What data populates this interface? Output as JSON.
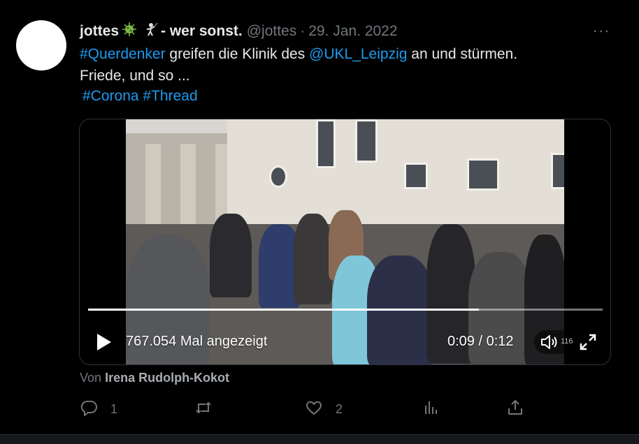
{
  "tweet": {
    "display_name": "jottes",
    "name_suffix": "- wer sonst.",
    "handle": "@jottes",
    "separator": "·",
    "date": "29. Jan. 2022",
    "more_label": "···",
    "text": {
      "hashtag1": "#Querdenker",
      "part1": " greifen die Klinik des ",
      "mention": "@UKL_Leipzig",
      "part2": " an und stürmen.",
      "line2": "Friede, und so ...",
      "hashtag2": "#Corona",
      "hashtag3": "#Thread"
    }
  },
  "video": {
    "views": "767.054 Mal angezeigt",
    "time": "0:09 / 0:12",
    "volume_level": "116",
    "progress_fraction": 0.76
  },
  "credit": {
    "prefix": "Von",
    "author": "Irena Rudolph-Kokot"
  },
  "actions": {
    "reply_count": "1",
    "retweet_count": "",
    "like_count": "2"
  },
  "colors": {
    "link": "#1d9bf0",
    "muted": "#71767b",
    "text": "#e7e9ea",
    "background": "#000000"
  },
  "icons": [
    "more-icon",
    "virus-emoji-icon",
    "fencer-emoji-icon",
    "play-icon",
    "volume-icon",
    "fullscreen-icon",
    "reply-icon",
    "retweet-icon",
    "like-icon",
    "views-icon",
    "share-icon"
  ]
}
